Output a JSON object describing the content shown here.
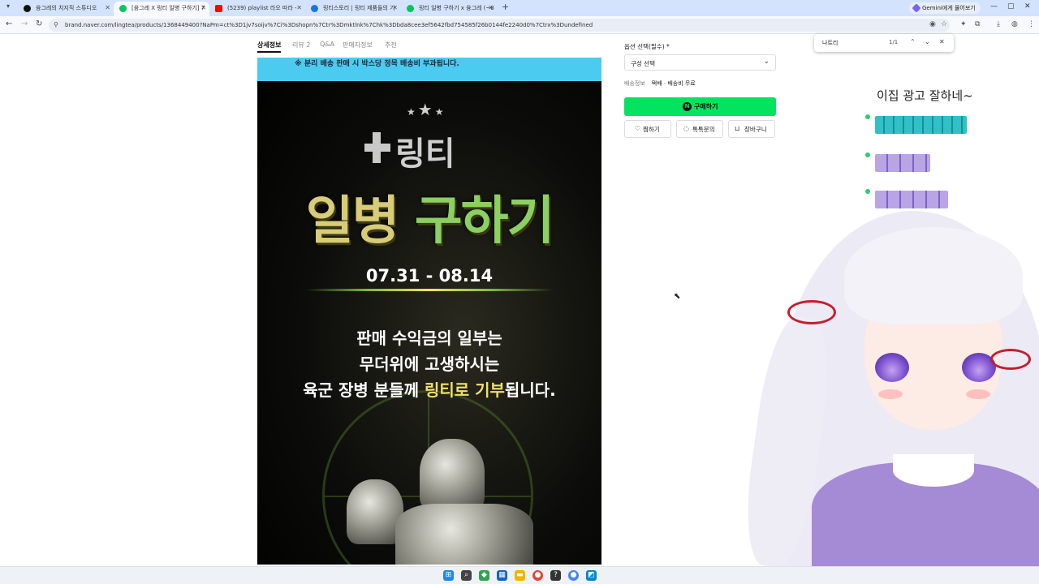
{
  "browser": {
    "tabs": [
      {
        "title": "융그레의 치지직 스튜디오",
        "color": "#111111"
      },
      {
        "title": "[융그레 X 링티 일병 구하기] 7",
        "color": "#03c75a"
      },
      {
        "title": "(5239) playlist 라오 따라 -",
        "color": "#ff0000"
      },
      {
        "title": "링티스토리 | 링티 제품들의 기",
        "color": "#1a73e8"
      },
      {
        "title": "링티 일병 구하기 x 융그레 (~8",
        "color": "#03c75a"
      }
    ],
    "new_tab": "+",
    "gemini_label": "Gemini에게 물어보기",
    "url": "brand.naver.com/lingtea/products/1368449400?NaPm=ct%3D1jv7soijv%7Ci%3Dshopn%7Ctr%3Dmktlnk%7Chk%3Dbda8cee3ef5642fbd754585f26b0144fe2240d0%7Ctrx%3Dundefined"
  },
  "find": {
    "query": "나트리",
    "count": "1/1"
  },
  "product_tabs": [
    "상세정보",
    "리뷰 2",
    "Q&A",
    "판매자정보",
    "추천"
  ],
  "poster": {
    "notice": "※ 분리 배송 판매 시 박스당 정목 배송비 부과됩니다.",
    "brand": "링티",
    "headline_a": "일병",
    "headline_b": "구하기",
    "date": "07.31 - 08.14",
    "message_line1": "판매 수익금의 일부는",
    "message_line2": "무더위에 고생하시는",
    "message_line3_a": "육군 장병 분들께 ",
    "message_line3_b": "링티로 기부",
    "message_line3_c": "됩니다."
  },
  "purchase": {
    "option_label": "옵션 선택(필수) *",
    "option_value": "구성 선택",
    "ship_label": "배송정보",
    "ship_value": "택배 · 배송비 무료",
    "buy_label": "구매하기",
    "buy_badge": "N",
    "wish_label": "찜하기",
    "talk_label": "톡톡문의",
    "cart_label": "장바구니"
  },
  "chat": {
    "title": "이집 광고 잘하네~"
  },
  "colors": {
    "buy_green": "#03e35f",
    "notice_blue": "#4ccbf1"
  }
}
